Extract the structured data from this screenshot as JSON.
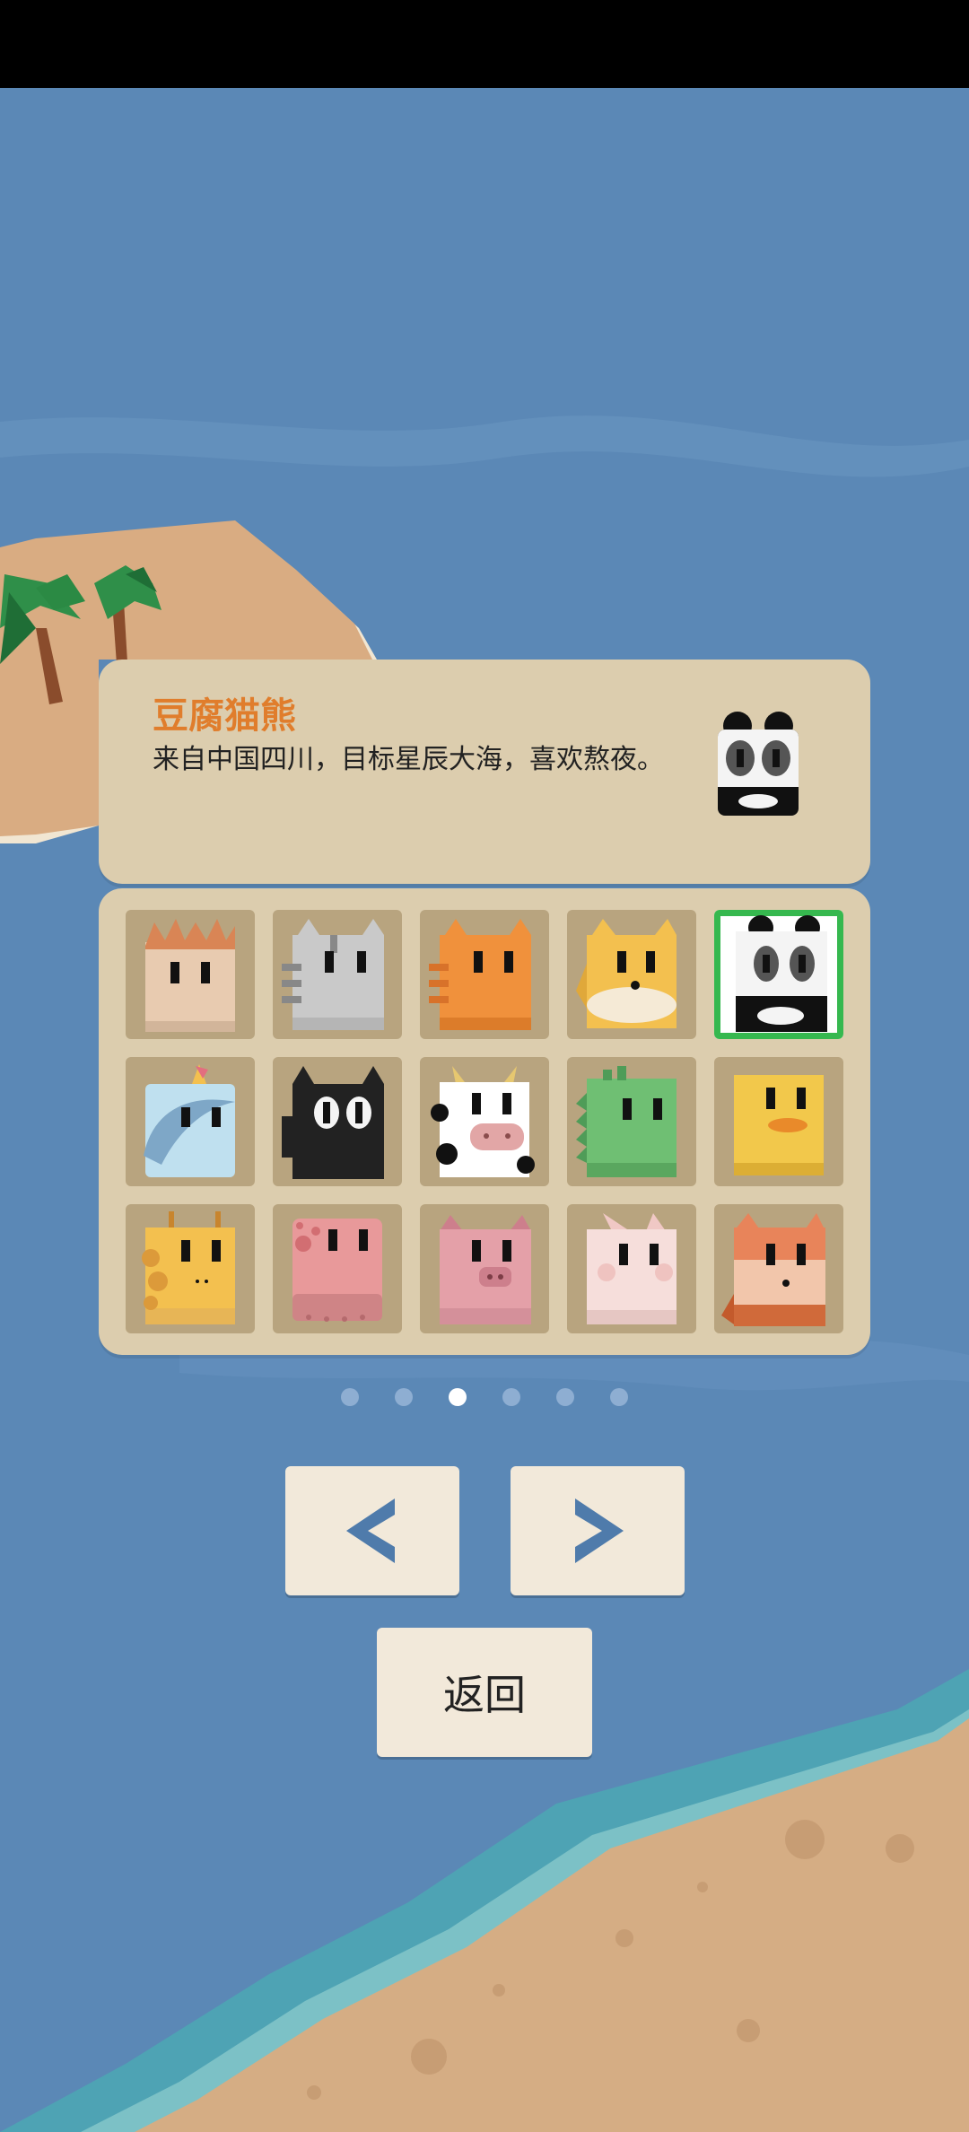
{
  "selected": {
    "name": "豆腐猫熊",
    "description": "来自中国四川，目标星辰大海，喜欢熬夜。"
  },
  "characters": [
    {
      "id": "hedgehog",
      "icon": "hedgehog-character-icon",
      "color": "#e8cbb0"
    },
    {
      "id": "gray-cat",
      "icon": "gray-tabby-cat-character-icon",
      "color": "#c9c9c9"
    },
    {
      "id": "orange-cat",
      "icon": "orange-tabby-cat-character-icon",
      "color": "#f0913c"
    },
    {
      "id": "shiba",
      "icon": "shiba-dog-character-icon",
      "color": "#f3c04f"
    },
    {
      "id": "panda",
      "icon": "panda-character-icon",
      "color": "#ffffff",
      "selected": true
    },
    {
      "id": "unicorn",
      "icon": "unicorn-character-icon",
      "color": "#bfe0ef"
    },
    {
      "id": "black-cat",
      "icon": "black-cat-character-icon",
      "color": "#222222"
    },
    {
      "id": "cow",
      "icon": "cow-character-icon",
      "color": "#ffffff"
    },
    {
      "id": "dinosaur",
      "icon": "green-dinosaur-character-icon",
      "color": "#6fbf73"
    },
    {
      "id": "duck",
      "icon": "duck-character-icon",
      "color": "#f2c84b"
    },
    {
      "id": "giraffe",
      "icon": "giraffe-character-icon",
      "color": "#f3c04f"
    },
    {
      "id": "octopus",
      "icon": "octopus-character-icon",
      "color": "#e8999a"
    },
    {
      "id": "pig",
      "icon": "pig-character-icon",
      "color": "#e4a0a8"
    },
    {
      "id": "rabbit",
      "icon": "rabbit-character-icon",
      "color": "#f6dedb"
    },
    {
      "id": "fox",
      "icon": "fox-character-icon",
      "color": "#e8845a"
    }
  ],
  "pagination": {
    "total": 6,
    "current": 3
  },
  "buttons": {
    "prev_icon": "chevron-left-icon",
    "next_icon": "chevron-right-icon",
    "back_label": "返回"
  },
  "colors": {
    "ocean": "#5b88b6",
    "panel": "#dccdae",
    "name_accent": "#e07d2c",
    "selected_border": "#36b84f",
    "button_bg": "#f2e9da",
    "arrow": "#4f7bab",
    "sand": "#d5ad84"
  }
}
